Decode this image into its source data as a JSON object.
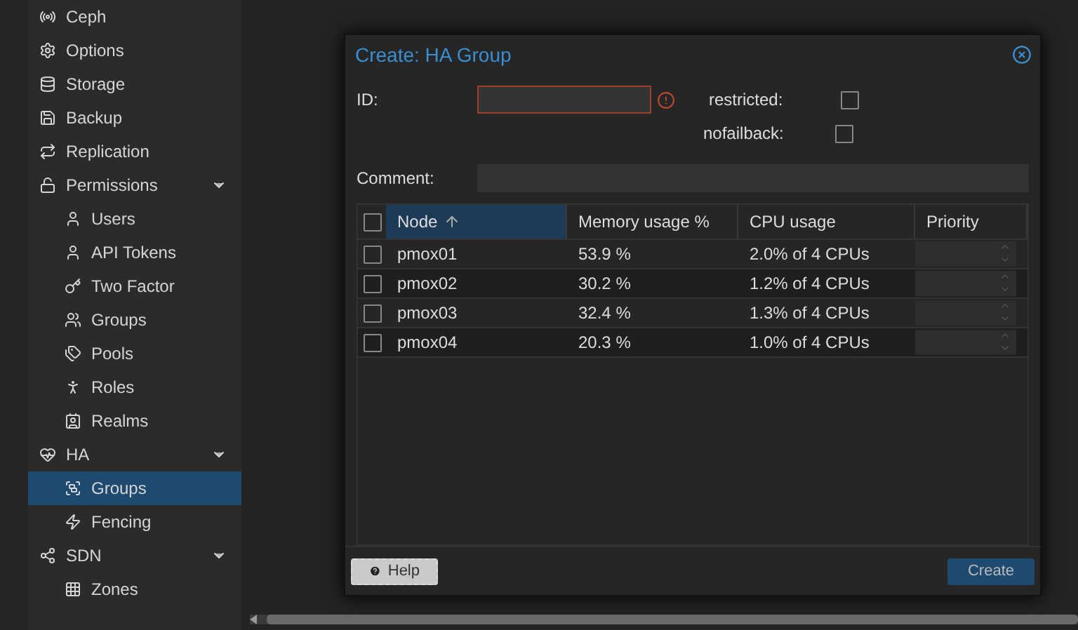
{
  "sidebar": {
    "items": [
      {
        "label": "Ceph",
        "selected": false
      },
      {
        "label": "Options",
        "selected": false
      },
      {
        "label": "Storage",
        "selected": false
      },
      {
        "label": "Backup",
        "selected": false
      },
      {
        "label": "Replication",
        "selected": false
      },
      {
        "label": "Permissions",
        "selected": false,
        "expanded": true,
        "children": [
          {
            "label": "Users",
            "selected": false
          },
          {
            "label": "API Tokens",
            "selected": false
          },
          {
            "label": "Two Factor",
            "selected": false
          },
          {
            "label": "Groups",
            "selected": false
          },
          {
            "label": "Pools",
            "selected": false
          },
          {
            "label": "Roles",
            "selected": false
          },
          {
            "label": "Realms",
            "selected": false
          }
        ]
      },
      {
        "label": "HA",
        "selected": false,
        "expanded": true,
        "children": [
          {
            "label": "Groups",
            "selected": true
          },
          {
            "label": "Fencing",
            "selected": false
          }
        ]
      },
      {
        "label": "SDN",
        "selected": false,
        "expanded": true,
        "children": [
          {
            "label": "Zones",
            "selected": false
          }
        ]
      }
    ]
  },
  "dialog": {
    "title": "Create: HA Group",
    "id_field": {
      "label": "ID:",
      "invalid": true
    },
    "restricted": {
      "label": "restricted:",
      "checked": false
    },
    "nofailback": {
      "label": "nofailback:",
      "checked": false
    },
    "comment": {
      "label": "Comment:"
    },
    "table": {
      "all_checked": false,
      "columns": [
        {
          "label": "Node",
          "sorted": true
        },
        {
          "label": "Memory usage %",
          "sorted": false
        },
        {
          "label": "CPU usage",
          "sorted": false
        },
        {
          "label": "Priority",
          "sorted": false
        }
      ],
      "rows": [
        {
          "checked": false,
          "node": "pmox01",
          "memory": "53.9 %",
          "cpu": "2.0% of 4 CPUs"
        },
        {
          "checked": false,
          "node": "pmox02",
          "memory": "30.2 %",
          "cpu": "1.2% of 4 CPUs"
        },
        {
          "checked": false,
          "node": "pmox03",
          "memory": "32.4 %",
          "cpu": "1.3% of 4 CPUs"
        },
        {
          "checked": false,
          "node": "pmox04",
          "memory": "20.3 %",
          "cpu": "1.0% of 4 CPUs"
        }
      ]
    },
    "buttons": [
      {
        "label": "Help",
        "kind": "help"
      },
      {
        "label": "Create",
        "kind": "primary"
      }
    ]
  }
}
